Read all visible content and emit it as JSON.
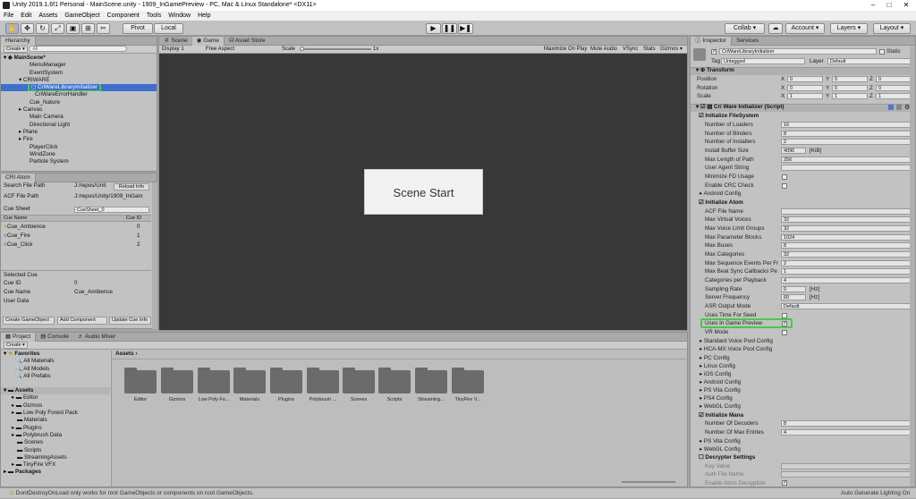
{
  "title": "Unity 2019.1.6f1 Personal - MainScene.unity - 1909_InGamePreview - PC, Mac & Linux Standalone* <DX11>",
  "menu": [
    "File",
    "Edit",
    "Assets",
    "GameObject",
    "Component",
    "Tools",
    "Window",
    "Help"
  ],
  "toolbar": {
    "pivot": "Pivot",
    "local": "Local",
    "collab": "Collab ▾",
    "account": "Account ▾",
    "layers": "Layers ▾",
    "layout": "Layout ▾"
  },
  "hierarchy": {
    "tab": "Hierarchy",
    "create": "Create ▾",
    "search": "All",
    "scene": "MainScene*",
    "items": [
      "MenuManager",
      "EventSystem",
      "CRIWARE",
      "CriWareLibraryInitializer",
      "CriWareErrorHandler",
      "Cue_Nature",
      "Canvas",
      "Main Camera",
      "Directional Light",
      "Plane",
      "Fire",
      "PlayerClick",
      "WindZone",
      "Particle System"
    ]
  },
  "criatom": {
    "tab": "CRI Atom",
    "search_path_label": "Search File Path",
    "search_path": "J:/repos/Unit",
    "reload": "Reload Info",
    "acf_label": "ACF File Path",
    "acf": "J:/repos/Unity/1909_InGam",
    "cuesheet_label": "Cue Sheet",
    "cuesheet": "CueSheet_0",
    "col_name": "Cue Name",
    "col_id": "Cue ID",
    "cues": [
      {
        "name": "Cue_Ambience",
        "id": "0"
      },
      {
        "name": "Cue_Fire",
        "id": "1"
      },
      {
        "name": "Cue_Click",
        "id": "2"
      }
    ],
    "selected_cue": "Selected Cue",
    "cue_id_label": "Cue ID",
    "cue_id": "0",
    "cue_name_label": "Cue Name",
    "cue_name": "Cue_Ambience",
    "user_data": "User Data",
    "btn_create": "Create GameObject",
    "btn_add": "Add Component",
    "btn_update": "Update Cue Info"
  },
  "scene_tabs": {
    "scene": "Scene",
    "game": "Game",
    "asset_store": "Asset Store"
  },
  "game": {
    "display": "Display 1",
    "aspect": "Free Aspect",
    "scale": "Scale",
    "scale_val": "1x",
    "maximize": "Maximize On Play",
    "mute": "Mute Audio",
    "vsync": "VSync",
    "stats": "Stats",
    "gizmos": "Gizmos ▾",
    "button": "Scene Start"
  },
  "project": {
    "tab": "Project",
    "console": "Console",
    "audio": "Audio Mixer",
    "create": "Create ▾",
    "favorites": "Favorites",
    "fav_items": [
      "All Materials",
      "All Models",
      "All Prefabs"
    ],
    "assets": "Assets",
    "packages": "Packages",
    "tree": [
      "Editor",
      "Gizmos",
      "Low Poly Forest Pack",
      "Materials",
      "Plugins",
      "Polybrush Data",
      "Scenes",
      "Scripts",
      "StreamingAssets",
      "TinyFire VFX"
    ],
    "grid": [
      "Editor",
      "Gizmos",
      "Low Poly Fo...",
      "Materials",
      "Plugins",
      "Polybrush ...",
      "Scenes",
      "Scripts",
      "Streaming...",
      "TinyFire V..."
    ]
  },
  "inspector": {
    "tab": "Inspector",
    "services": "Services",
    "object": "CriWareLibraryInitializer",
    "static": "Static",
    "tag_label": "Tag",
    "tag": "Untagged",
    "layer_label": "Layer",
    "layer": "Default",
    "transform": "Transform",
    "pos": "Position",
    "rot": "Rotation",
    "scale": "Scale",
    "tvals": {
      "px": "0",
      "py": "0",
      "pz": "0",
      "rx": "0",
      "ry": "0",
      "rz": "0",
      "sx": "1",
      "sy": "1",
      "sz": "1"
    },
    "script": "Cri Ware Initializer (Script)",
    "fs_head": "Initialize FileSystem",
    "fs": [
      [
        "Number of Loaders",
        "16"
      ],
      [
        "Number of Binders",
        "8"
      ],
      [
        "Number of Installers",
        "2"
      ],
      [
        "Install Buffer Size",
        "4096"
      ],
      [
        "Max Length of Path",
        "256"
      ],
      [
        "User Agent String",
        ""
      ]
    ],
    "kib": "[KiB]",
    "min_fd": "Minimize FD Usage",
    "crc": "Enable CRC Check",
    "android": "Android Config",
    "atom_head": "Initialize Atom",
    "atom": [
      [
        "ACF File Name",
        ""
      ],
      [
        "Max Virtual Voices",
        "32"
      ],
      [
        "Max Voice Limit Groups",
        "32"
      ],
      [
        "Max Parameter Blocks",
        "1024"
      ],
      [
        "Max Buses",
        "8"
      ],
      [
        "Max Categories",
        "32"
      ],
      [
        "Max Sequence Events Per Fr",
        "2"
      ],
      [
        "Max Beat Sync Callbacks Pe",
        "1"
      ],
      [
        "Categories per Playback",
        "4"
      ],
      [
        "Sampling Rate",
        "0"
      ],
      [
        "Server Frequency",
        "60"
      ],
      [
        "ASR Output Mode",
        "Default"
      ]
    ],
    "hz": "[Hz]",
    "use_seed": "Uses Time For Seed",
    "in_game": "Uses In Game Preview",
    "vr": "VR Mode",
    "folds": [
      "Standard Voice Pool Config",
      "HCA-MX Voice Pool Config",
      "PC Config",
      "Linux Config",
      "iOS Config",
      "Android Config",
      "PS Vita Config",
      "PS4 Config",
      "WebGL Config"
    ],
    "mana_head": "Initialize Mana",
    "decoders": "Number Of Decoders",
    "decoders_v": "8",
    "entries": "Number Of Max Entries",
    "entries_v": "4",
    "mana_folds": [
      "PS Vita Config",
      "WebGL Config"
    ],
    "decrypt": "Decrypter Settings",
    "key": "Key Value",
    "auth": "Auth File Name",
    "atom_dec": "Enable Atom Decryption"
  },
  "status": {
    "msg": "DontDestroyOnLoad only works for root GameObjects or components on root GameObjects.",
    "right": "Auto Generate Lighting On"
  }
}
